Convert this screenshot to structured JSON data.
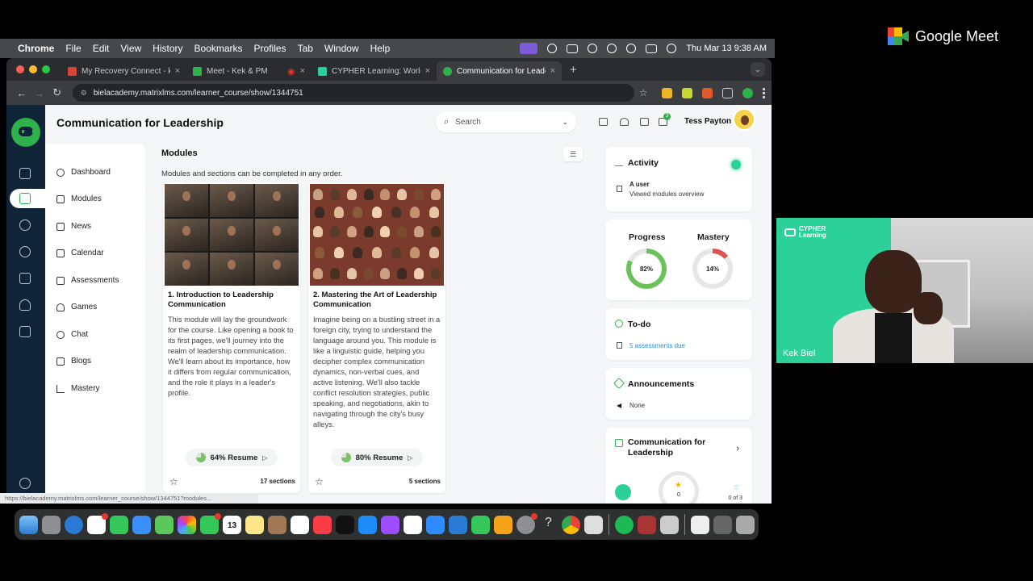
{
  "menubar": {
    "app": "Chrome",
    "menus": [
      "File",
      "Edit",
      "View",
      "History",
      "Bookmarks",
      "Profiles",
      "Tab",
      "Window",
      "Help"
    ],
    "clock": "Thu Mar 13  9:38 AM"
  },
  "browser": {
    "tabs": [
      {
        "title": "My Recovery Connect - kek@",
        "favicon_color": "#d44638"
      },
      {
        "title": "Meet - Kek & PM",
        "favicon_color": "#2fb14b"
      },
      {
        "title": "CYPHER Learning: World's le",
        "favicon_color": "#2bd199"
      },
      {
        "title": "Communication for Leadershi",
        "favicon_color": "#2fb14b"
      }
    ],
    "url": "bielacademy.matrixlms.com/learner_course/show/1344751",
    "hover_url": "https://bielacademy.matrixlms.com/learner_course/show/1344751?modules..."
  },
  "page": {
    "title": "Communication for Leadership",
    "search_placeholder": "Search",
    "cart_count": "3",
    "user_name": "Tess Payton",
    "nav": [
      "Dashboard",
      "Modules",
      "News",
      "Calendar",
      "Assessments",
      "Games",
      "Chat",
      "Blogs",
      "Mastery"
    ],
    "modules_heading": "Modules",
    "modules_subtitle": "Modules and sections can be completed in any order.",
    "cards": [
      {
        "title": "1. Introduction to Leadership Communication",
        "description": "This module will lay the groundwork for the course. Like opening a book to its first pages, we'll journey into the realm of leadership communication. We'll learn about its importance, how it differs from regular communication, and the role it plays in a leader's profile.",
        "resume_label": "64% Resume",
        "progress": 0.64,
        "sections": "17 sections"
      },
      {
        "title": "2. Mastering the Art of Leadership Communication",
        "description": "Imagine being on a bustling street in a foreign city, trying to understand the language around you. This module is like a linguistic guide, helping you decipher complex communication dynamics, non-verbal cues, and active listening. We'll also tackle conflict resolution strategies, public speaking, and negotiations, akin to navigating through the city's busy alleys.",
        "resume_label": "80% Resume",
        "progress": 0.8,
        "sections": "5 sections"
      }
    ],
    "activity": {
      "title": "Activity",
      "actor": "A user",
      "action": "Viewed modules overview"
    },
    "progress": {
      "label": "Progress",
      "value_text": "82%",
      "value": 0.82,
      "color": "#6cc25a"
    },
    "mastery": {
      "label": "Mastery",
      "value_text": "14%",
      "value": 0.14,
      "color": "#e0514f"
    },
    "todo": {
      "title": "To-do",
      "item": "5 assessments due"
    },
    "announcements": {
      "title": "Announcements",
      "item": "None"
    },
    "course_card": {
      "title": "Communication for Leadership",
      "stars": "0",
      "count": "0 of 3"
    }
  },
  "meet": {
    "brand": "Google Meet",
    "participant": "Kek Biel",
    "video_brand": "CYPHER\nLearning"
  },
  "dock": {
    "calendar_day": "13"
  }
}
